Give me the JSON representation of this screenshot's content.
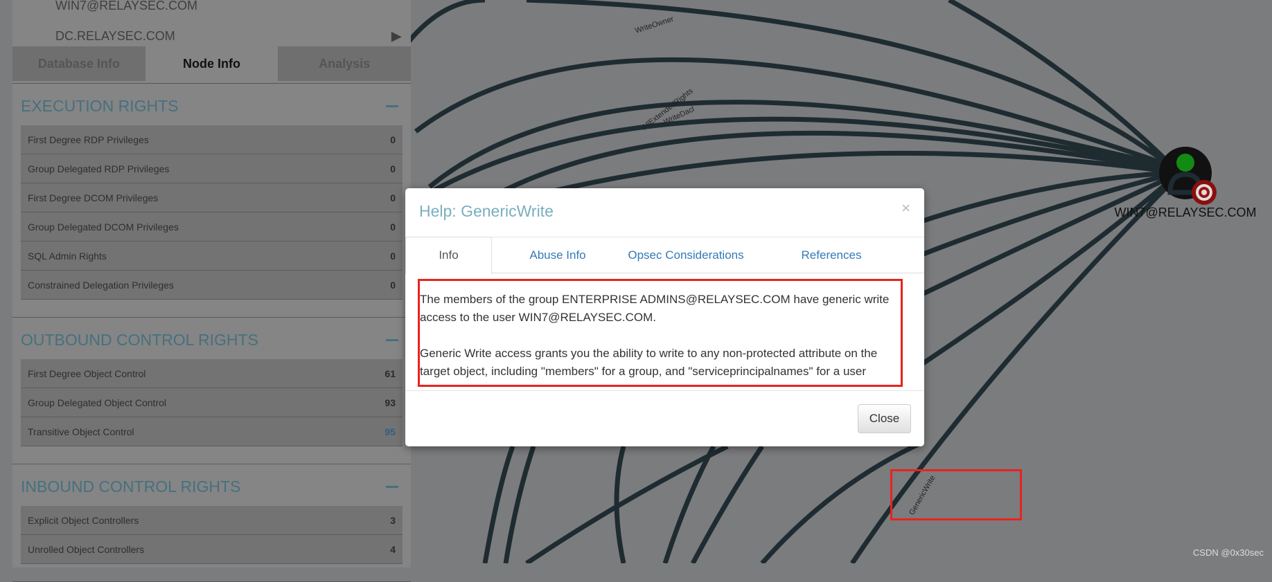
{
  "sidebar": {
    "node_rows": [
      "WIN7@RELAYSEC.COM",
      "DC.RELAYSEC.COM"
    ],
    "tabs": [
      "Database Info",
      "Node Info",
      "Analysis"
    ],
    "active_tab": "Node Info",
    "sections": [
      {
        "title": "EXECUTION RIGHTS",
        "rows": [
          {
            "label": "First Degree RDP Privileges",
            "value": "0"
          },
          {
            "label": "Group Delegated RDP Privileges",
            "value": "0"
          },
          {
            "label": "First Degree DCOM Privileges",
            "value": "0"
          },
          {
            "label": "Group Delegated DCOM Privileges",
            "value": "0"
          },
          {
            "label": "SQL Admin Rights",
            "value": "0"
          },
          {
            "label": "Constrained Delegation Privileges",
            "value": "0"
          }
        ]
      },
      {
        "title": "OUTBOUND CONTROL RIGHTS",
        "rows": [
          {
            "label": "First Degree Object Control",
            "value": "61"
          },
          {
            "label": "Group Delegated Object Control",
            "value": "93"
          },
          {
            "label": "Transitive Object Control",
            "value": "95"
          }
        ]
      },
      {
        "title": "INBOUND CONTROL RIGHTS",
        "rows": [
          {
            "label": "Explicit Object Controllers",
            "value": "3"
          },
          {
            "label": "Unrolled Object Controllers",
            "value": "4"
          }
        ]
      }
    ]
  },
  "graph": {
    "target_node": "WIN7@RELAYSEC.COM",
    "edge_labels": [
      "WriteOwner",
      "AllExtendedRights",
      "WriteDacl",
      "GenericWrite"
    ],
    "node_color": "#138a13",
    "target_color": "#a01010"
  },
  "modal": {
    "title": "Help: GenericWrite",
    "close_x": "×",
    "tabs": [
      "Info",
      "Abuse Info",
      "Opsec Considerations",
      "References"
    ],
    "active_tab": "Info",
    "paragraphs": [
      "The members of the group ENTERPRISE ADMINS@RELAYSEC.COM have generic write access to the user WIN7@RELAYSEC.COM.",
      "Generic Write access grants you the ability to write to any non-protected attribute on the target object, including \"members\" for a group, and \"serviceprincipalnames\" for a user"
    ],
    "close_button": "Close"
  },
  "watermark": "CSDN @0x30sec"
}
